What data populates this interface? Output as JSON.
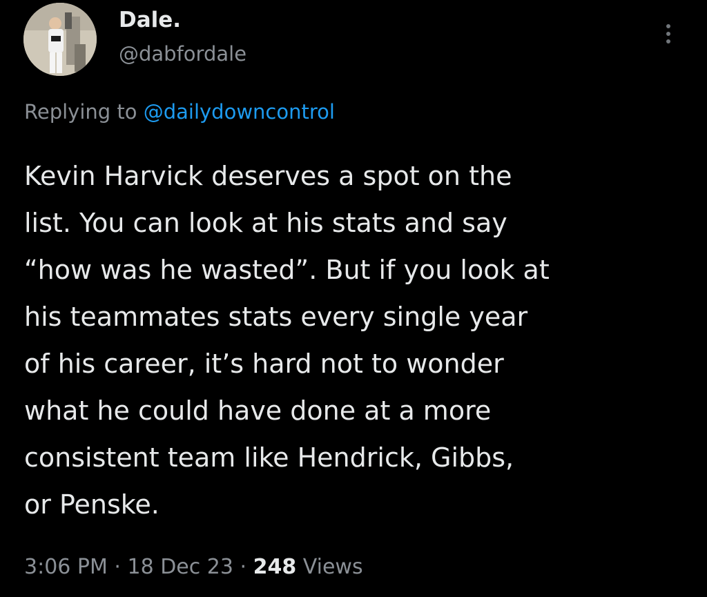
{
  "author": {
    "display_name": "Dale.",
    "handle": "@dabfordale",
    "avatar": "user-avatar-photo"
  },
  "more_icon": "more-vertical-dots-icon",
  "reply": {
    "prefix": "Replying to ",
    "mention": "@dailydowncontrol"
  },
  "tweet": {
    "text": "Kevin Harvick deserves a spot on the\nlist. You can look at his stats and say\n“how was he wasted”. But if you look at\nhis teammates stats every single year\nof his career, it’s hard not to wonder\nwhat he could have done at a more\nconsistent team like Hendrick, Gibbs,\nor Penske."
  },
  "meta": {
    "time": "3:06 PM",
    "separator1": " · ",
    "date": "18 Dec 23",
    "separator2": " · ",
    "views_count": "248",
    "views_label": " Views"
  },
  "colors": {
    "background": "#000000",
    "text_primary": "#e7e9ea",
    "text_secondary": "#8b9096",
    "link": "#1d9bf0"
  }
}
